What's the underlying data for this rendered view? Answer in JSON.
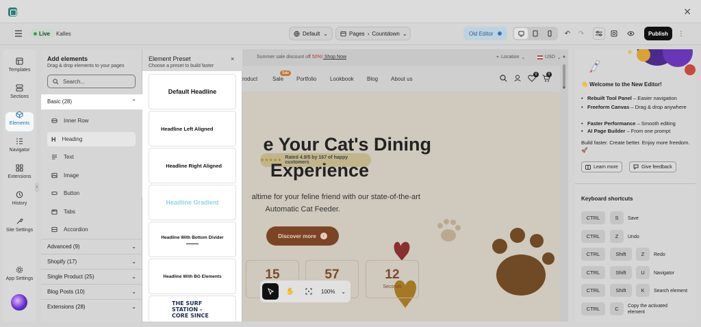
{
  "topbar": {
    "live_label": "Live",
    "store_name": "Kalles",
    "language": "Default",
    "page_prefix": "Pages",
    "page_name": "Countdown",
    "old_editor": "Old Editor",
    "publish": "Publish"
  },
  "rail": [
    {
      "label": "Templates",
      "icon": "templates-icon"
    },
    {
      "label": "Sections",
      "icon": "sections-icon"
    },
    {
      "label": "Elements",
      "icon": "elements-icon"
    },
    {
      "label": "Navigator",
      "icon": "navigator-icon"
    },
    {
      "label": "Extensions",
      "icon": "extensions-icon"
    },
    {
      "label": "History",
      "icon": "history-icon"
    },
    {
      "label": "Site Settings",
      "icon": "site-settings-icon"
    },
    {
      "label": "App Settings",
      "icon": "app-settings-icon"
    }
  ],
  "add_elements": {
    "title": "Add elements",
    "subtitle": "Drag & drop elements to your pages",
    "search_placeholder": "Search...",
    "basic_label": "Basic (28)",
    "basic_items": [
      "Inner Row",
      "Heading",
      "Text",
      "Image",
      "Button",
      "Tabs",
      "Accordion"
    ],
    "categories": [
      "Advanced (9)",
      "Shopify (17)",
      "Single Product (25)",
      "Blog Posts (10)",
      "Extensions (28)"
    ]
  },
  "preset": {
    "title": "Element Preset",
    "subtitle": "Choose a preset to build faster",
    "close": "×",
    "items": [
      "Default Headline",
      "Headline Left Aligned",
      "Headline Right Aligned",
      "Headline Gradient",
      "Headline With Bottom Divider",
      "Headline With BG Elements"
    ],
    "partial_item": "THE SURF STATION - CORE SINCE"
  },
  "canvas": {
    "announcement_text": "Summer sale discount off ",
    "announcement_percent": "50%!",
    "announcement_link": " Shop Now",
    "location": "Location",
    "currency": "USD",
    "nav": [
      "roduct",
      "Sale",
      "Portfolio",
      "Lookbook",
      "Blog",
      "About us"
    ],
    "sale_badge": "Sale",
    "wishlist_count": "0",
    "cart_count": "0",
    "rating": "Rated 4.9/5 by 167 of happy customers",
    "stars": "★★★★★",
    "heading_line1": "e Your Cat's Dining",
    "heading_line2": "Experience",
    "sub_line1": "altime for your feline friend with our state-of-the-art",
    "sub_line2": "Automatic Cat Feeder.",
    "cta": "Discover more",
    "countdown": [
      {
        "value": "15",
        "label": ""
      },
      {
        "value": "57",
        "label": ""
      },
      {
        "value": "12",
        "label": "Seconds"
      }
    ],
    "zoom": "100%"
  },
  "right_panel": {
    "welcome": "👋 Welcome to the New Editor!",
    "bullets": [
      {
        "bold": "Rebuilt Tool Panel",
        "rest": " – Easier navigation"
      },
      {
        "bold": "Freeform Canvas",
        "rest": " – Drag & drop anywhere"
      },
      {
        "bold": "Faster Performance",
        "rest": " – Smooth editing"
      },
      {
        "bold": "AI Page Builder",
        "rest": " – From one prompt"
      }
    ],
    "build_text": "Build faster. Create better. Enjoy more freedom. 🚀",
    "learn_more": "Learn more",
    "give_feedback": "Give feedback",
    "shortcuts_title": "Keyboard shortcuts",
    "shortcuts": [
      {
        "keys": [
          "CTRL",
          "S"
        ],
        "desc": "Save"
      },
      {
        "keys": [
          "CTRL",
          "Z"
        ],
        "desc": "Undo"
      },
      {
        "keys": [
          "CTRL",
          "Shift",
          "Z"
        ],
        "desc": "Redo"
      },
      {
        "keys": [
          "CTRL",
          "Shift",
          "U"
        ],
        "desc": "Navigator"
      },
      {
        "keys": [
          "CTRL",
          "Shift",
          "K"
        ],
        "desc": "Search element"
      },
      {
        "keys": [
          "CTRL",
          "C"
        ],
        "desc": "Copy the activated element"
      }
    ]
  },
  "colors": {
    "accent": "#2b7d7a",
    "cta": "#7c4424",
    "live_dot": "#2da44e"
  }
}
